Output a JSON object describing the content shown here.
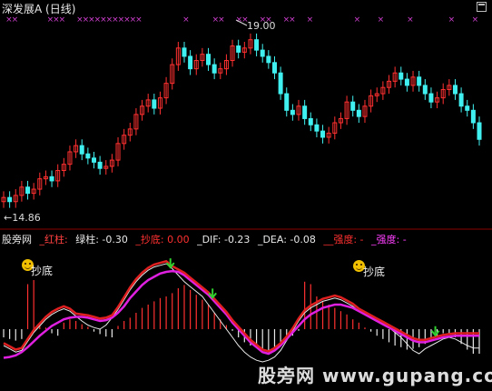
{
  "window": {
    "title": "深发展A (日线)"
  },
  "price_panel": {
    "high_label": "19.00",
    "low_label": "←14.86"
  },
  "indicator_panel": {
    "name": "股旁网",
    "items": [
      {
        "key": "red_bar",
        "text": "_红柱: ",
        "color": "#ff4040"
      },
      {
        "key": "green_bar",
        "text": "绿柱: -0.30",
        "color": "#e8e8e8"
      },
      {
        "key": "bottom",
        "text": "_抄底: 0.00",
        "color": "#ff3030"
      },
      {
        "key": "dif",
        "text": "_DIF: -0.23",
        "color": "#e8e8e8"
      },
      {
        "key": "dea",
        "text": "_DEA: -0.08",
        "color": "#e8e8e8"
      },
      {
        "key": "strength_red",
        "text": "__强度: -",
        "color": "#ff3030"
      },
      {
        "key": "strength_purple",
        "text": "_强度: -",
        "color": "#ff40ff"
      }
    ],
    "signal_label": "抄底",
    "signal_count": 2
  },
  "watermark": "股旁网 www.gupang.com",
  "colors": {
    "up": "#ff3030",
    "down": "#40f0f0",
    "marker": "#d040d0",
    "dif": "#e8e8e8",
    "dea": "#e020e0",
    "red_strength": "#e02020",
    "green_arrow": "#30d030"
  },
  "chart_data": [
    {
      "type": "candlestick",
      "series_name": "深发展A",
      "high": 19.0,
      "low": 14.86,
      "close": [
        15.1,
        15.0,
        15.15,
        15.35,
        15.2,
        15.3,
        15.55,
        15.6,
        15.5,
        15.75,
        15.9,
        16.2,
        16.35,
        16.15,
        16.05,
        15.95,
        15.8,
        15.85,
        16.0,
        16.4,
        16.6,
        16.75,
        17.1,
        17.3,
        17.45,
        17.25,
        17.5,
        17.85,
        18.3,
        18.7,
        18.5,
        18.2,
        18.4,
        18.55,
        18.3,
        18.1,
        18.2,
        18.4,
        18.75,
        18.6,
        18.7,
        18.9,
        18.65,
        18.5,
        18.35,
        18.1,
        17.6,
        17.2,
        17.1,
        17.3,
        17.0,
        16.85,
        16.7,
        16.55,
        16.65,
        16.9,
        17.0,
        17.4,
        17.2,
        17.05,
        17.3,
        17.55,
        17.6,
        17.75,
        17.9,
        18.1,
        17.95,
        17.8,
        18.0,
        17.8,
        17.6,
        17.4,
        17.5,
        17.7,
        17.8,
        17.6,
        17.3,
        17.2,
        16.9,
        16.5
      ],
      "markers": "x"
    },
    {
      "type": "bar",
      "series_name": "MACD",
      "bars": [
        -0.1,
        -0.12,
        -0.14,
        -0.12,
        0.55,
        0.6,
        0.05,
        0.02,
        -0.05,
        -0.08,
        0.08,
        0.12,
        0.1,
        0.06,
        0.03,
        -0.03,
        -0.06,
        -0.09,
        -0.1,
        0.04,
        0.1,
        0.14,
        0.2,
        0.26,
        0.3,
        0.34,
        0.38,
        0.4,
        0.44,
        0.5,
        0.54,
        0.48,
        0.42,
        0.36,
        0.3,
        0.2,
        0.12,
        0.05,
        -0.02,
        -0.1,
        -0.16,
        -0.2,
        -0.22,
        -0.25,
        -0.28,
        -0.24,
        -0.2,
        -0.14,
        -0.08,
        -0.02,
        0.58,
        0.55,
        0.4,
        0.34,
        0.3,
        0.26,
        0.22,
        0.18,
        0.12,
        0.08,
        0.02,
        -0.03,
        -0.08,
        -0.12,
        -0.16,
        -0.2,
        -0.22,
        -0.25,
        -0.24,
        -0.22,
        -0.18,
        -0.12,
        -0.08,
        -0.05,
        -0.06,
        -0.1,
        -0.18,
        -0.25,
        -0.3,
        -0.3
      ],
      "dif": [
        -0.2,
        -0.24,
        -0.28,
        -0.26,
        -0.15,
        -0.04,
        0.04,
        0.12,
        0.18,
        0.22,
        0.25,
        0.22,
        0.16,
        0.1,
        0.05,
        0.02,
        0.0,
        0.05,
        0.14,
        0.24,
        0.36,
        0.48,
        0.58,
        0.66,
        0.72,
        0.76,
        0.78,
        0.8,
        0.74,
        0.66,
        0.58,
        0.52,
        0.46,
        0.4,
        0.3,
        0.2,
        0.1,
        0.0,
        -0.1,
        -0.2,
        -0.28,
        -0.34,
        -0.38,
        -0.4,
        -0.38,
        -0.34,
        -0.26,
        -0.14,
        -0.02,
        0.1,
        0.2,
        0.26,
        0.3,
        0.34,
        0.36,
        0.38,
        0.36,
        0.32,
        0.28,
        0.22,
        0.18,
        0.14,
        0.1,
        0.06,
        0.02,
        -0.04,
        -0.1,
        -0.18,
        -0.26,
        -0.3,
        -0.24,
        -0.2,
        -0.16,
        -0.12,
        -0.1,
        -0.12,
        -0.16,
        -0.2,
        -0.23,
        -0.23
      ],
      "dea": [
        -0.35,
        -0.34,
        -0.32,
        -0.28,
        -0.22,
        -0.15,
        -0.08,
        -0.02,
        0.04,
        0.08,
        0.12,
        0.14,
        0.15,
        0.15,
        0.14,
        0.12,
        0.1,
        0.11,
        0.14,
        0.2,
        0.28,
        0.38,
        0.46,
        0.54,
        0.6,
        0.64,
        0.68,
        0.7,
        0.71,
        0.7,
        0.66,
        0.6,
        0.54,
        0.48,
        0.42,
        0.34,
        0.26,
        0.18,
        0.08,
        0.0,
        -0.08,
        -0.16,
        -0.22,
        -0.28,
        -0.3,
        -0.26,
        -0.2,
        -0.12,
        -0.04,
        0.04,
        0.12,
        0.18,
        0.22,
        0.26,
        0.28,
        0.3,
        0.3,
        0.28,
        0.26,
        0.22,
        0.18,
        0.14,
        0.1,
        0.06,
        0.02,
        -0.02,
        -0.06,
        -0.1,
        -0.14,
        -0.16,
        -0.16,
        -0.14,
        -0.12,
        -0.1,
        -0.09,
        -0.08,
        -0.08,
        -0.08,
        -0.08,
        -0.08
      ]
    }
  ]
}
